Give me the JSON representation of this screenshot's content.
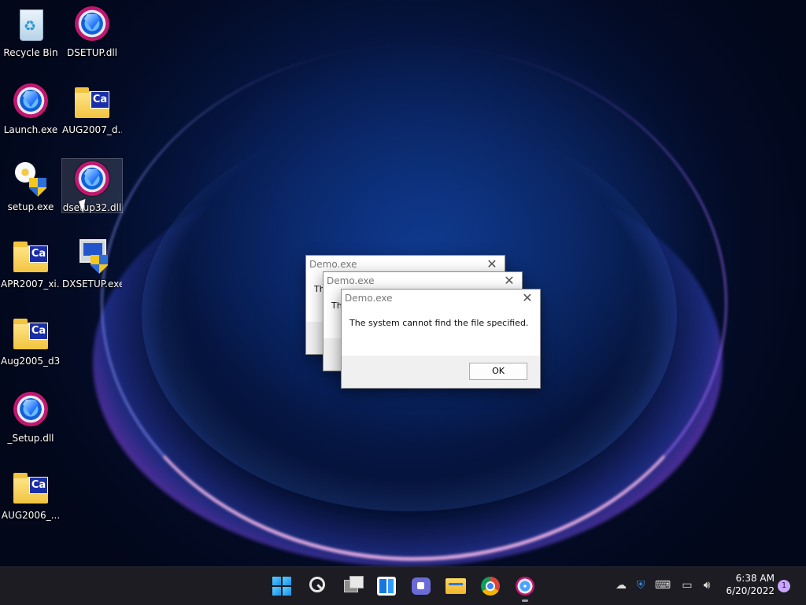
{
  "desktop": {
    "icons": [
      {
        "label": "Recycle Bin",
        "icon": "recycle-bin-icon"
      },
      {
        "label": "DSETUP.dll",
        "icon": "setup-gem-icon"
      },
      {
        "label": "Launch.exe",
        "icon": "setup-gem-icon"
      },
      {
        "label": "AUG2007_d...",
        "icon": "cab-folder-icon"
      },
      {
        "label": "setup.exe",
        "icon": "setup-installer-icon"
      },
      {
        "label": "dsetup32.dll",
        "icon": "setup-gem-icon",
        "selected": true
      },
      {
        "label": "APR2007_xi...",
        "icon": "cab-folder-icon"
      },
      {
        "label": "DXSETUP.exe",
        "icon": "dxsetup-icon"
      },
      {
        "label": "Aug2005_d3...",
        "icon": "cab-folder-icon"
      },
      {
        "label": "_Setup.dll",
        "icon": "setup-gem-icon"
      },
      {
        "label": "AUG2006_...",
        "icon": "cab-folder-icon"
      }
    ],
    "cab_badge": "Ca"
  },
  "dialogs": [
    {
      "title": "Demo.exe",
      "message_partial": "Th"
    },
    {
      "title": "Demo.exe",
      "message_partial": "Th"
    },
    {
      "title": "Demo.exe",
      "message": "The system cannot find the file specified.",
      "ok_label": "OK"
    }
  ],
  "taskbar": {
    "apps": [
      "start-icon",
      "search-icon",
      "task-view-icon",
      "widgets-icon",
      "chat-icon",
      "file-explorer-icon",
      "chrome-icon",
      "setup-gem-icon"
    ],
    "clock": {
      "time": "6:38 AM",
      "date": "6/20/2022"
    },
    "notification_count": "1"
  },
  "colors": {
    "accent": "#1a8fe8",
    "taskbar_bg": "#1c1c22"
  }
}
